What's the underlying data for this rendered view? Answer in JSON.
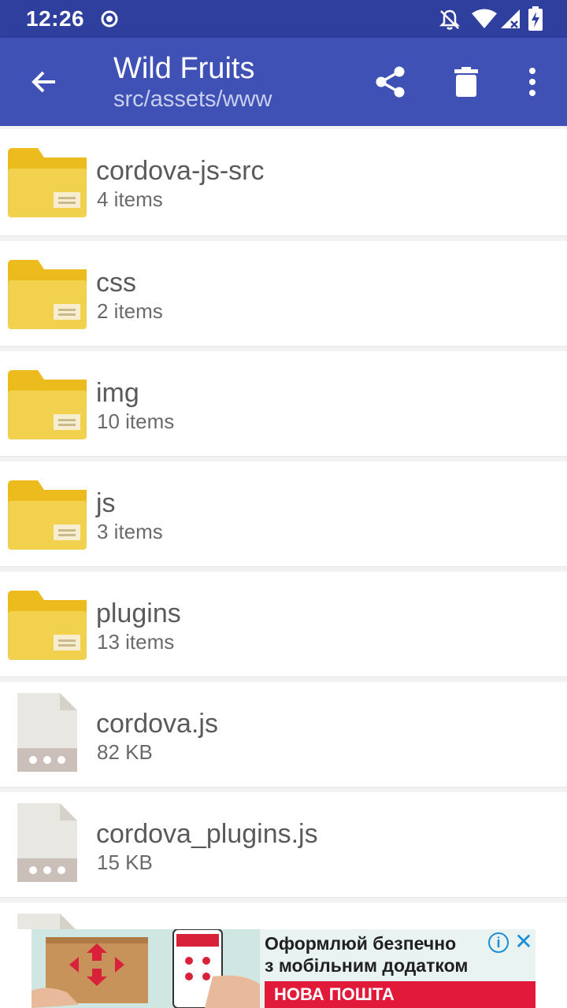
{
  "status_bar": {
    "time": "12:26",
    "icons": [
      "record-icon",
      "notifications-off-icon",
      "wifi-icon",
      "signal-icon",
      "battery-charging-icon"
    ]
  },
  "app_bar": {
    "title": "Wild Fruits",
    "subtitle": "src/assets/www",
    "actions": [
      "back-icon",
      "share-icon",
      "delete-icon",
      "more-vert-icon"
    ]
  },
  "items": [
    {
      "name": "cordova-js-src",
      "meta": "4 items",
      "type": "folder"
    },
    {
      "name": "css",
      "meta": "2 items",
      "type": "folder"
    },
    {
      "name": "img",
      "meta": "10 items",
      "type": "folder"
    },
    {
      "name": "js",
      "meta": "3 items",
      "type": "folder"
    },
    {
      "name": "plugins",
      "meta": "13 items",
      "type": "folder"
    },
    {
      "name": "cordova.js",
      "meta": "82 KB",
      "type": "file"
    },
    {
      "name": "cordova_plugins.js",
      "meta": "15 KB",
      "type": "file"
    }
  ],
  "ad": {
    "line1": "Оформлюй безпечно",
    "line2": "з мобільним додатком",
    "brand": "НОВА ПОШТА"
  },
  "colors": {
    "status_bar": "#2f3f9e",
    "app_bar": "#3f51b5",
    "folder": "#f2d14e",
    "folder_tab": "#ecbb1e",
    "file": "#e9e7e1",
    "file_footer": "#cbbfb9"
  }
}
